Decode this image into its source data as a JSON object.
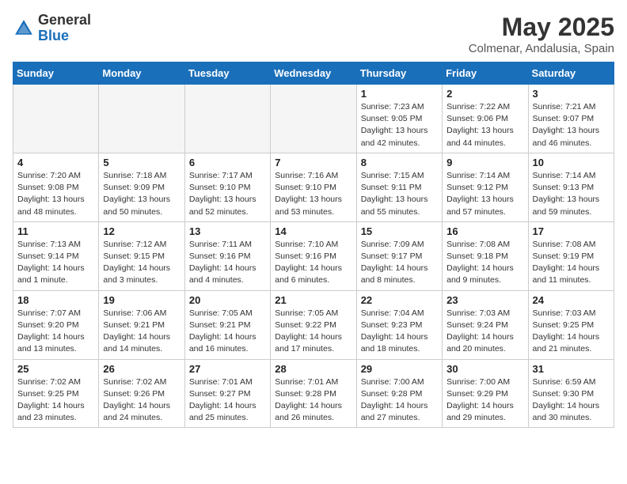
{
  "header": {
    "logo_general": "General",
    "logo_blue": "Blue",
    "month_title": "May 2025",
    "location": "Colmenar, Andalusia, Spain"
  },
  "calendar": {
    "weekdays": [
      "Sunday",
      "Monday",
      "Tuesday",
      "Wednesday",
      "Thursday",
      "Friday",
      "Saturday"
    ],
    "weeks": [
      [
        {
          "day": "",
          "empty": true
        },
        {
          "day": "",
          "empty": true
        },
        {
          "day": "",
          "empty": true
        },
        {
          "day": "",
          "empty": true
        },
        {
          "day": "1",
          "sunrise": "7:23 AM",
          "sunset": "9:05 PM",
          "daylight": "13 hours and 42 minutes."
        },
        {
          "day": "2",
          "sunrise": "7:22 AM",
          "sunset": "9:06 PM",
          "daylight": "13 hours and 44 minutes."
        },
        {
          "day": "3",
          "sunrise": "7:21 AM",
          "sunset": "9:07 PM",
          "daylight": "13 hours and 46 minutes."
        }
      ],
      [
        {
          "day": "4",
          "sunrise": "7:20 AM",
          "sunset": "9:08 PM",
          "daylight": "13 hours and 48 minutes."
        },
        {
          "day": "5",
          "sunrise": "7:18 AM",
          "sunset": "9:09 PM",
          "daylight": "13 hours and 50 minutes."
        },
        {
          "day": "6",
          "sunrise": "7:17 AM",
          "sunset": "9:10 PM",
          "daylight": "13 hours and 52 minutes."
        },
        {
          "day": "7",
          "sunrise": "7:16 AM",
          "sunset": "9:10 PM",
          "daylight": "13 hours and 53 minutes."
        },
        {
          "day": "8",
          "sunrise": "7:15 AM",
          "sunset": "9:11 PM",
          "daylight": "13 hours and 55 minutes."
        },
        {
          "day": "9",
          "sunrise": "7:14 AM",
          "sunset": "9:12 PM",
          "daylight": "13 hours and 57 minutes."
        },
        {
          "day": "10",
          "sunrise": "7:14 AM",
          "sunset": "9:13 PM",
          "daylight": "13 hours and 59 minutes."
        }
      ],
      [
        {
          "day": "11",
          "sunrise": "7:13 AM",
          "sunset": "9:14 PM",
          "daylight": "14 hours and 1 minute."
        },
        {
          "day": "12",
          "sunrise": "7:12 AM",
          "sunset": "9:15 PM",
          "daylight": "14 hours and 3 minutes."
        },
        {
          "day": "13",
          "sunrise": "7:11 AM",
          "sunset": "9:16 PM",
          "daylight": "14 hours and 4 minutes."
        },
        {
          "day": "14",
          "sunrise": "7:10 AM",
          "sunset": "9:16 PM",
          "daylight": "14 hours and 6 minutes."
        },
        {
          "day": "15",
          "sunrise": "7:09 AM",
          "sunset": "9:17 PM",
          "daylight": "14 hours and 8 minutes."
        },
        {
          "day": "16",
          "sunrise": "7:08 AM",
          "sunset": "9:18 PM",
          "daylight": "14 hours and 9 minutes."
        },
        {
          "day": "17",
          "sunrise": "7:08 AM",
          "sunset": "9:19 PM",
          "daylight": "14 hours and 11 minutes."
        }
      ],
      [
        {
          "day": "18",
          "sunrise": "7:07 AM",
          "sunset": "9:20 PM",
          "daylight": "14 hours and 13 minutes."
        },
        {
          "day": "19",
          "sunrise": "7:06 AM",
          "sunset": "9:21 PM",
          "daylight": "14 hours and 14 minutes."
        },
        {
          "day": "20",
          "sunrise": "7:05 AM",
          "sunset": "9:21 PM",
          "daylight": "14 hours and 16 minutes."
        },
        {
          "day": "21",
          "sunrise": "7:05 AM",
          "sunset": "9:22 PM",
          "daylight": "14 hours and 17 minutes."
        },
        {
          "day": "22",
          "sunrise": "7:04 AM",
          "sunset": "9:23 PM",
          "daylight": "14 hours and 18 minutes."
        },
        {
          "day": "23",
          "sunrise": "7:03 AM",
          "sunset": "9:24 PM",
          "daylight": "14 hours and 20 minutes."
        },
        {
          "day": "24",
          "sunrise": "7:03 AM",
          "sunset": "9:25 PM",
          "daylight": "14 hours and 21 minutes."
        }
      ],
      [
        {
          "day": "25",
          "sunrise": "7:02 AM",
          "sunset": "9:25 PM",
          "daylight": "14 hours and 23 minutes."
        },
        {
          "day": "26",
          "sunrise": "7:02 AM",
          "sunset": "9:26 PM",
          "daylight": "14 hours and 24 minutes."
        },
        {
          "day": "27",
          "sunrise": "7:01 AM",
          "sunset": "9:27 PM",
          "daylight": "14 hours and 25 minutes."
        },
        {
          "day": "28",
          "sunrise": "7:01 AM",
          "sunset": "9:28 PM",
          "daylight": "14 hours and 26 minutes."
        },
        {
          "day": "29",
          "sunrise": "7:00 AM",
          "sunset": "9:28 PM",
          "daylight": "14 hours and 27 minutes."
        },
        {
          "day": "30",
          "sunrise": "7:00 AM",
          "sunset": "9:29 PM",
          "daylight": "14 hours and 29 minutes."
        },
        {
          "day": "31",
          "sunrise": "6:59 AM",
          "sunset": "9:30 PM",
          "daylight": "14 hours and 30 minutes."
        }
      ]
    ]
  }
}
